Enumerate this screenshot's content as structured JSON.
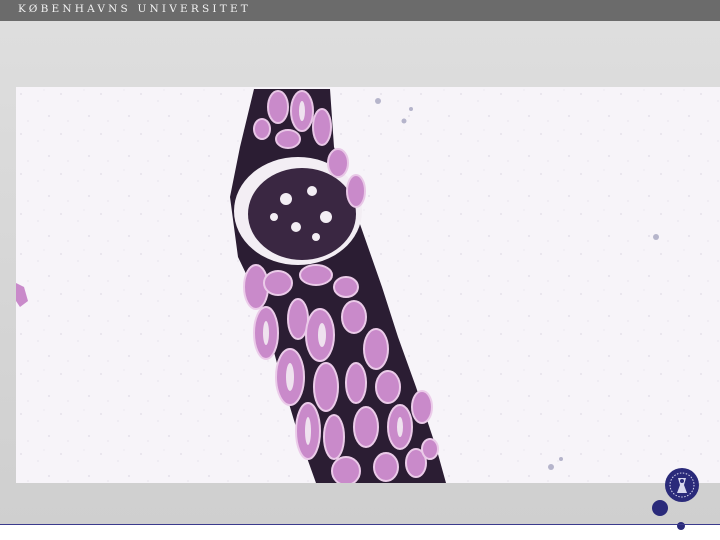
{
  "header": {
    "university_name": "KØBENHAVNS UNIVERSITET"
  },
  "image": {
    "subject": "kidney biopsy micrograph",
    "colors": {
      "background": "#f6f3f8",
      "tubule": "#c78ac8",
      "tubule_light": "#e4bde3",
      "stroma": "#2d1f34",
      "glomerulus": "#3a2742"
    }
  },
  "branding": {
    "accent": "#2a2a7a",
    "topbar": "#6b6b6b"
  }
}
